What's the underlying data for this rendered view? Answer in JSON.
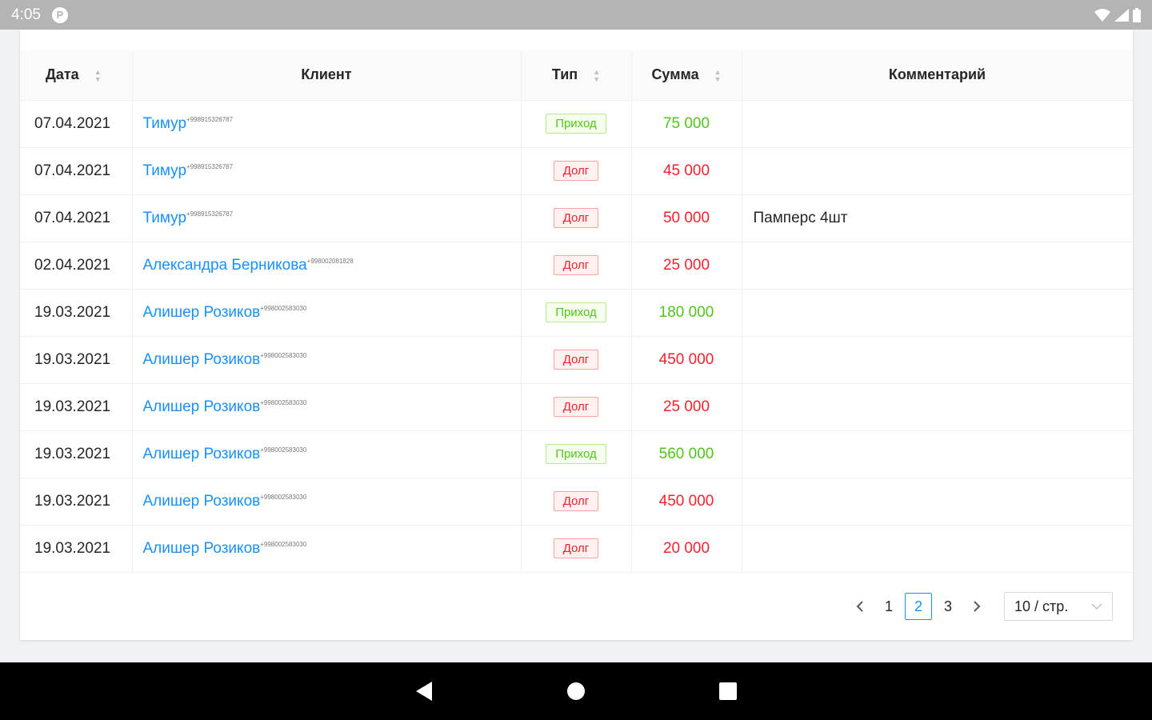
{
  "status_bar": {
    "time": "4:05",
    "app_icon": "P"
  },
  "table": {
    "columns": [
      {
        "key": "date",
        "label": "Дата",
        "sortable": true
      },
      {
        "key": "client",
        "label": "Клиент",
        "sortable": false
      },
      {
        "key": "type",
        "label": "Тип",
        "sortable": true
      },
      {
        "key": "sum",
        "label": "Сумма",
        "sortable": true
      },
      {
        "key": "comment",
        "label": "Комментарий",
        "sortable": false
      }
    ],
    "rows": [
      {
        "date": "07.04.2021",
        "client": "Тимур",
        "phone": "+998915326787",
        "type": "Приход",
        "kind": "income",
        "sum": "75 000",
        "comment": ""
      },
      {
        "date": "07.04.2021",
        "client": "Тимур",
        "phone": "+998915326787",
        "type": "Долг",
        "kind": "debt",
        "sum": "45 000",
        "comment": ""
      },
      {
        "date": "07.04.2021",
        "client": "Тимур",
        "phone": "+998915326787",
        "type": "Долг",
        "kind": "debt",
        "sum": "50 000",
        "comment": "Памперс 4шт"
      },
      {
        "date": "02.04.2021",
        "client": "Александра Берникова",
        "phone": "+998002081828",
        "type": "Долг",
        "kind": "debt",
        "sum": "25 000",
        "comment": ""
      },
      {
        "date": "19.03.2021",
        "client": "Алишер Розиков",
        "phone": "+998002583030",
        "type": "Приход",
        "kind": "income",
        "sum": "180 000",
        "comment": ""
      },
      {
        "date": "19.03.2021",
        "client": "Алишер Розиков",
        "phone": "+998002583030",
        "type": "Долг",
        "kind": "debt",
        "sum": "450 000",
        "comment": ""
      },
      {
        "date": "19.03.2021",
        "client": "Алишер Розиков",
        "phone": "+998002583030",
        "type": "Долг",
        "kind": "debt",
        "sum": "25 000",
        "comment": ""
      },
      {
        "date": "19.03.2021",
        "client": "Алишер Розиков",
        "phone": "+998002583030",
        "type": "Приход",
        "kind": "income",
        "sum": "560 000",
        "comment": ""
      },
      {
        "date": "19.03.2021",
        "client": "Алишер Розиков",
        "phone": "+998002583030",
        "type": "Долг",
        "kind": "debt",
        "sum": "450 000",
        "comment": ""
      },
      {
        "date": "19.03.2021",
        "client": "Алишер Розиков",
        "phone": "+998002583030",
        "type": "Долг",
        "kind": "debt",
        "sum": "20 000",
        "comment": ""
      }
    ]
  },
  "pagination": {
    "prev_icon": "chevron-left-icon",
    "next_icon": "chevron-right-icon",
    "pages": [
      "1",
      "2",
      "3"
    ],
    "current": "2",
    "page_size": "10 / стр."
  },
  "colors": {
    "link": "#1890ff",
    "income": "#52c41a",
    "debt": "#f5222d"
  }
}
